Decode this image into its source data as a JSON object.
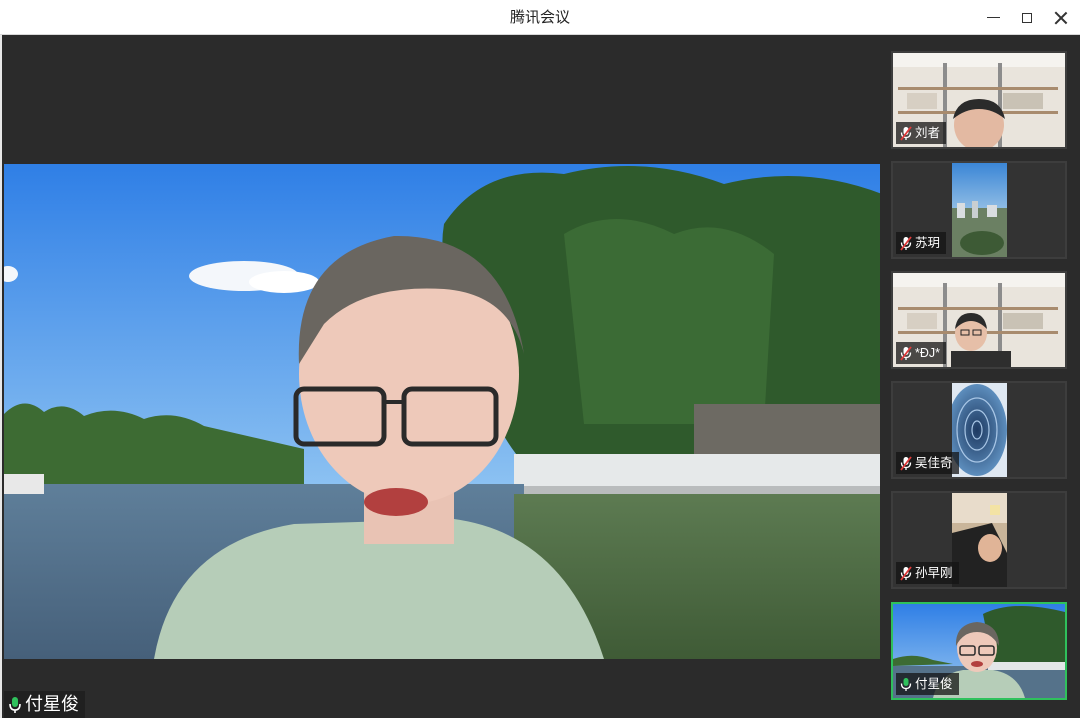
{
  "window": {
    "title": "腾讯会议",
    "controls": [
      "minimize-icon",
      "maximize-icon",
      "close-icon"
    ]
  },
  "main": {
    "speaker_name": "付星俊",
    "speaker_mic": "mic-on-icon"
  },
  "participants": [
    {
      "name": "刘者",
      "mic": "mic-muted-icon",
      "active": false
    },
    {
      "name": "苏玥",
      "mic": "mic-muted-icon",
      "active": false
    },
    {
      "name": "*ĐJ*",
      "mic": "mic-muted-icon",
      "active": false
    },
    {
      "name": "吴佳奇",
      "mic": "mic-muted-icon",
      "active": false
    },
    {
      "name": "孙早刚",
      "mic": "mic-muted-icon",
      "active": false
    },
    {
      "name": "付星俊",
      "mic": "mic-on-icon",
      "active": true
    }
  ],
  "colors": {
    "active_border": "#2fc15c",
    "mic_on": "#2fc15c",
    "mic_muted": "#e23b3b",
    "background": "#2b2b2b"
  }
}
